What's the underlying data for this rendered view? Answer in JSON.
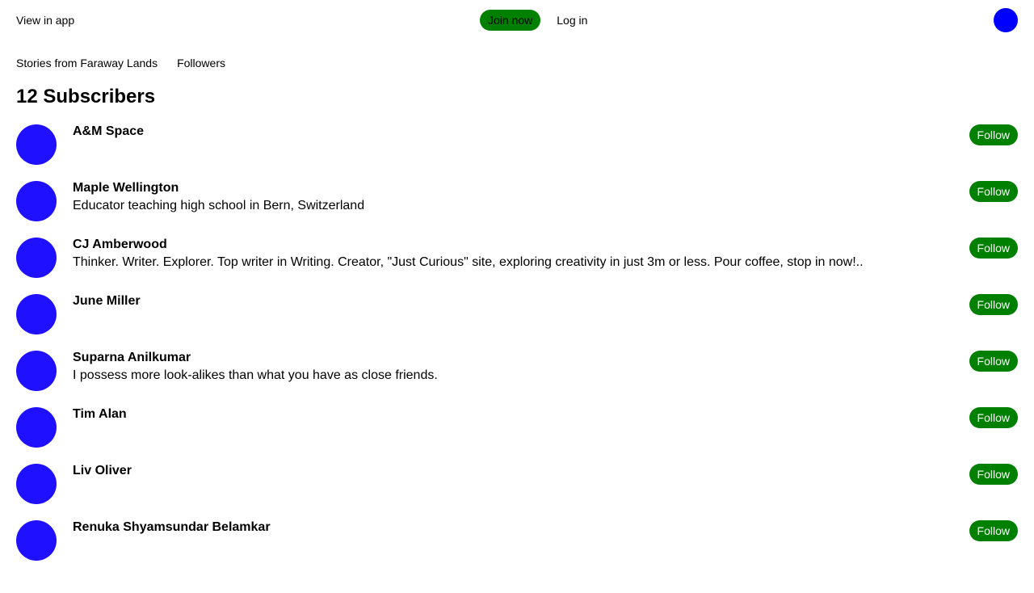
{
  "colors": {
    "accent_green": "#008000",
    "avatar_blue": "#1f10ff",
    "top_avatar_blue": "#0000ff",
    "text": "#000000"
  },
  "header": {
    "view_in_app": "View in app",
    "join_now": "Join now",
    "log_in": "Log in",
    "profile_icon": "user-avatar-icon"
  },
  "subnav": {
    "publication": "Stories from Faraway Lands",
    "followers": "Followers"
  },
  "main": {
    "title": "12 Subscribers",
    "follow_label": "Follow",
    "subscribers": [
      {
        "name": "A&M Space",
        "bio": ""
      },
      {
        "name": "Maple Wellington",
        "bio": "Educator teaching high school in Bern, Switzerland"
      },
      {
        "name": "CJ Amberwood",
        "bio": "Thinker. Writer. Explorer. Top writer in Writing. Creator, \"Just Curious\" site, exploring creativity in just 3m or less. Pour coffee, stop in now!.."
      },
      {
        "name": "June Miller",
        "bio": ""
      },
      {
        "name": "Suparna Anilkumar",
        "bio": "I possess more look-alikes than what you have as close friends."
      },
      {
        "name": "Tim Alan",
        "bio": ""
      },
      {
        "name": "Liv Oliver",
        "bio": ""
      },
      {
        "name": "Renuka Shyamsundar Belamkar",
        "bio": ""
      }
    ]
  }
}
